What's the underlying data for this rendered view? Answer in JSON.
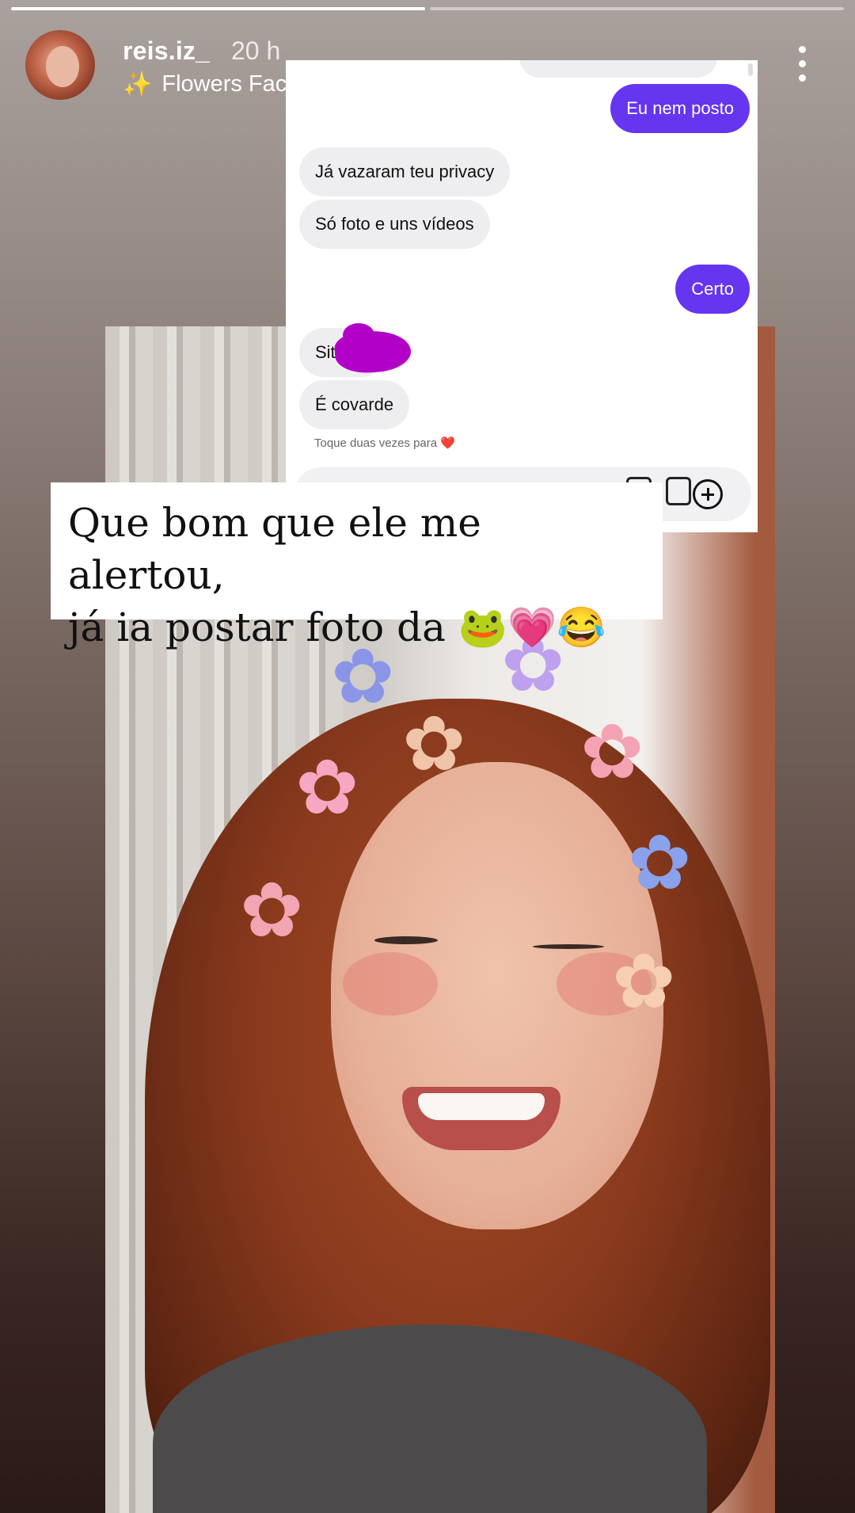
{
  "progress": {
    "segments_total": 2,
    "segments_done": 1
  },
  "header": {
    "username": "reis.iz_",
    "time": "20 h",
    "effect_name": "Flowers Face",
    "effect_icon": "sparkle-icon",
    "more_icon": "more-vertical-icon"
  },
  "chat": {
    "messages": [
      {
        "side": "out",
        "text": "Eu nem posto"
      },
      {
        "side": "in",
        "text": "Já vazaram teu privacy"
      },
      {
        "side": "in",
        "text": "Só foto e uns vídeos"
      },
      {
        "side": "out",
        "text": "Certo"
      },
      {
        "side": "in",
        "text": "Site"
      },
      {
        "side": "in",
        "text": "É covarde"
      }
    ],
    "double_tap_hint": "Toque duas vezes para ❤️",
    "accent_color": "#6535f0"
  },
  "caption": {
    "line1": "Que bom que ele me alertou,",
    "line2": "já ia postar foto da 🐸💗😂"
  }
}
